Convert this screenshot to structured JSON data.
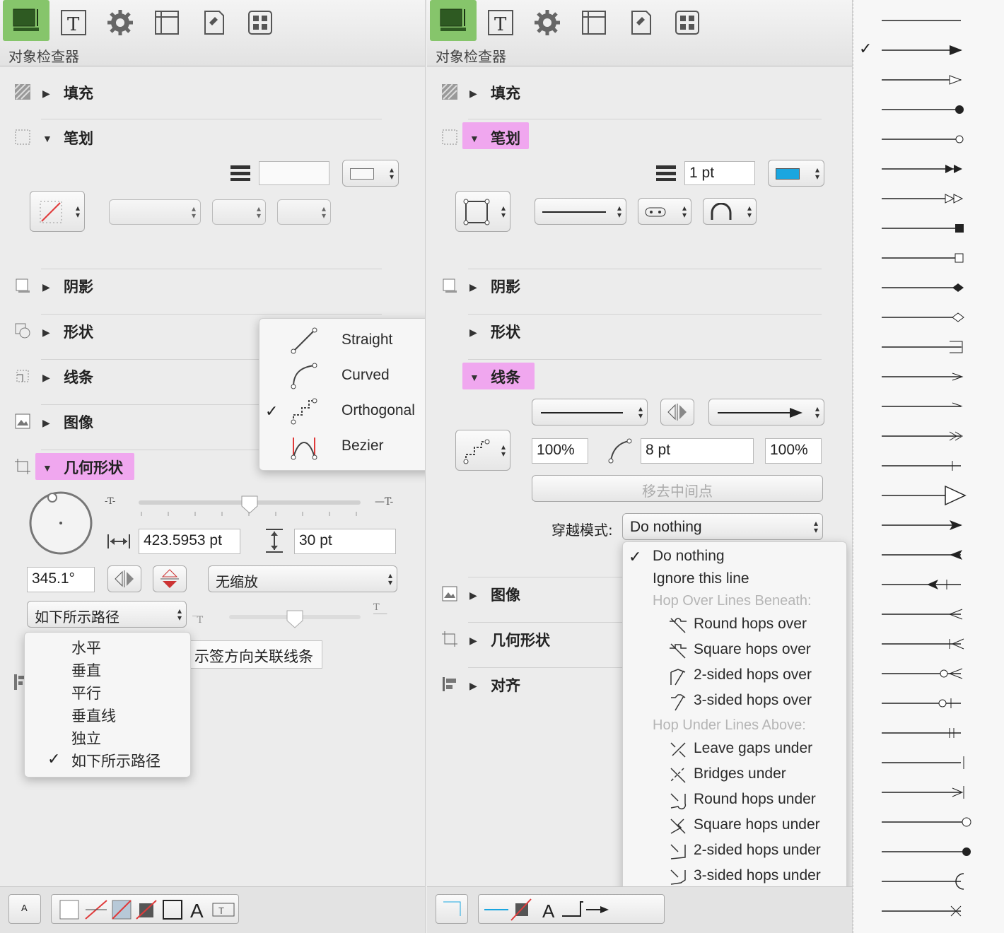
{
  "colors": {
    "highlight": "#f0a7ef",
    "active_tab": "#86c56b",
    "stroke_swatch": "#1aa6e0"
  },
  "left": {
    "title": "对象检查器",
    "sections": {
      "fill": "填充",
      "stroke": "笔划",
      "shadow": "阴影",
      "shape": "形状",
      "lines": "线条",
      "image": "图像",
      "geometry": "几何形状"
    },
    "geometry": {
      "width": "423.5953 pt",
      "height": "30 pt",
      "angle": "345.1°",
      "scale": "无缩放",
      "path_mode": "如下所示路径"
    },
    "line_type_menu": {
      "items": [
        "Straight",
        "Curved",
        "Orthogonal",
        "Bezier"
      ],
      "checked": "Orthogonal"
    },
    "path_menu": {
      "items": [
        "水平",
        "垂直",
        "平行",
        "垂直线",
        "独立",
        "如下所示路径"
      ],
      "checked": "如下所示路径"
    },
    "tooltip": "示签方向关联线条",
    "bottom_text_icon": "A"
  },
  "right": {
    "title": "对象检查器",
    "sections": {
      "fill": "填充",
      "stroke": "笔划",
      "shadow": "阴影",
      "shape": "形状",
      "lines": "线条",
      "image": "图像",
      "geometry": "几何形状",
      "align": "对齐"
    },
    "stroke_width": "1 pt",
    "line": {
      "scale_start": "100%",
      "corner_radius": "8 pt",
      "scale_end": "100%",
      "remove_midpoints": "移去中间点",
      "crossing_label": "穿越模式:",
      "crossing_value": "Do nothing"
    },
    "crossing_menu": {
      "items": [
        "Do nothing",
        "Ignore this line"
      ],
      "checked": "Do nothing",
      "header_over": "Hop Over Lines Beneath:",
      "over_items": [
        "Round hops over",
        "Square hops over",
        "2-sided hops over",
        "3-sided hops over"
      ],
      "header_under": "Hop Under Lines Above:",
      "under_items": [
        "Leave gaps under",
        "Bridges under",
        "Round hops under",
        "Square hops under",
        "2-sided hops under",
        "3-sided hops under"
      ]
    },
    "bottom_text_icon": "A"
  },
  "arrowheads": {
    "checked_index": 1,
    "count": 31
  }
}
